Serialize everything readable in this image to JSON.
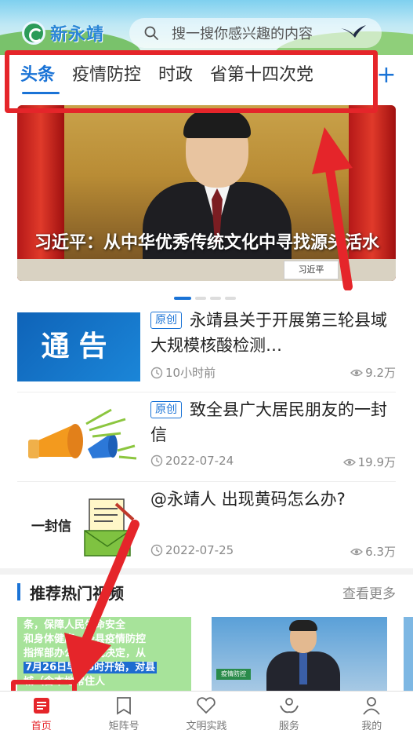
{
  "header": {
    "logo_text": "新永靖",
    "search_placeholder": "搜一搜你感兴趣的内容"
  },
  "tabs": [
    {
      "label": "头条",
      "active": true
    },
    {
      "label": "疫情防控",
      "active": false
    },
    {
      "label": "时政",
      "active": false
    },
    {
      "label": "省第十四次党",
      "active": false
    }
  ],
  "tab_add_symbol": "+",
  "banner": {
    "caption": "习近平：从中华优秀传统文化中寻找源头活水",
    "nameplate": "习近平",
    "slide_count": 4,
    "active_slide": 1
  },
  "news": [
    {
      "tag": "原创",
      "title": "永靖县关于开展第三轮县域大规模核酸检测…",
      "time": "10小时前",
      "views": "9.2万",
      "thumb_text": "通告"
    },
    {
      "tag": "原创",
      "title": "致全县广大居民朋友的一封信",
      "time": "2022-07-24",
      "views": "19.9万"
    },
    {
      "tag": "",
      "title": "@永靖人 出现黄码怎么办?",
      "time": "2022-07-25",
      "views": "6.3万",
      "thumb_text": "一封信"
    }
  ],
  "section": {
    "title": "推荐热门视频",
    "more": "查看更多"
  },
  "video1": {
    "lines": [
      "条，保障人民生命安全",
      "和身体健康，经县疫情防控",
      "指挥部办公室研究决定，从",
      "7月26日早上6时开始，对县",
      "城（含本地常住人"
    ]
  },
  "video2": {
    "badge": "疫情防控"
  },
  "bottom_nav": [
    {
      "label": "首页",
      "icon": "home-icon",
      "active": true
    },
    {
      "label": "矩阵号",
      "icon": "bookmark-icon",
      "active": false
    },
    {
      "label": "文明实践",
      "icon": "heart-icon",
      "active": false
    },
    {
      "label": "服务",
      "icon": "service-hands-icon",
      "active": false
    },
    {
      "label": "我的",
      "icon": "person-icon",
      "active": false
    }
  ],
  "colors": {
    "accent": "#1a73d6",
    "annotation": "#e5252a",
    "active_nav": "#e5252a"
  }
}
